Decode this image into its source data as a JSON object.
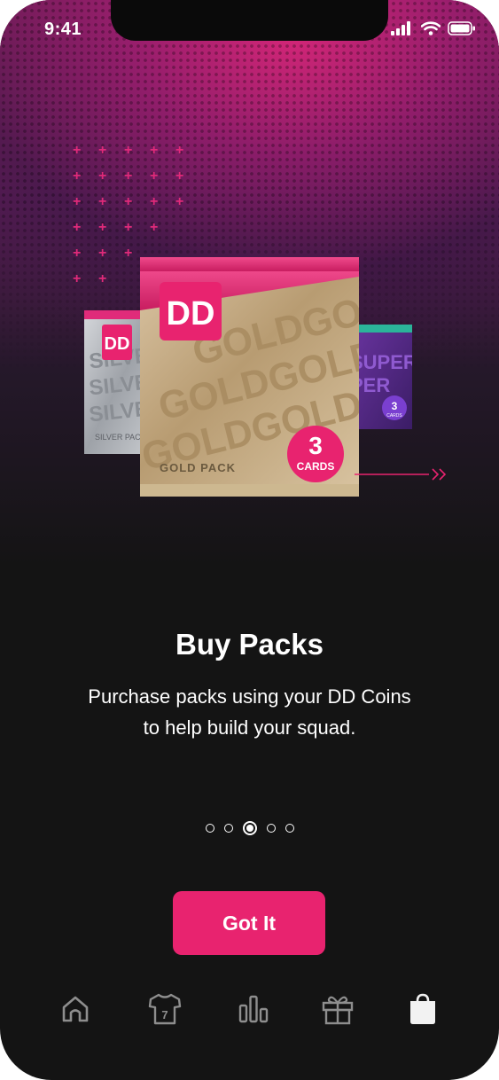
{
  "status_bar": {
    "time": "9:41"
  },
  "hero": {
    "packs": [
      {
        "name": "SILVER PACK",
        "word": "SILVER"
      },
      {
        "name": "GOLD PACK",
        "word": "GOLD",
        "count": "3",
        "count_label": "CARDS"
      },
      {
        "name": "SUPER PACK",
        "word": "SUPER",
        "count": "3",
        "count_label": "CARDS"
      }
    ],
    "logo_text": "DD"
  },
  "content": {
    "title": "Buy Packs",
    "description_line1": "Purchase packs using your DD Coins",
    "description_line2": "to help build your squad."
  },
  "pager": {
    "total": 5,
    "active_index": 2
  },
  "cta": {
    "label": "Got It"
  },
  "tabbar": {
    "items": [
      {
        "icon": "home-icon"
      },
      {
        "icon": "jersey-icon",
        "jersey_number": "7"
      },
      {
        "icon": "stats-icon"
      },
      {
        "icon": "gift-icon"
      },
      {
        "icon": "shopping-bag-icon",
        "active": true
      }
    ]
  },
  "colors": {
    "accent": "#e8236f",
    "background": "#141414",
    "gold": "#c9ad86",
    "silver": "#b9bcc0",
    "purple": "#5b2a8c"
  }
}
